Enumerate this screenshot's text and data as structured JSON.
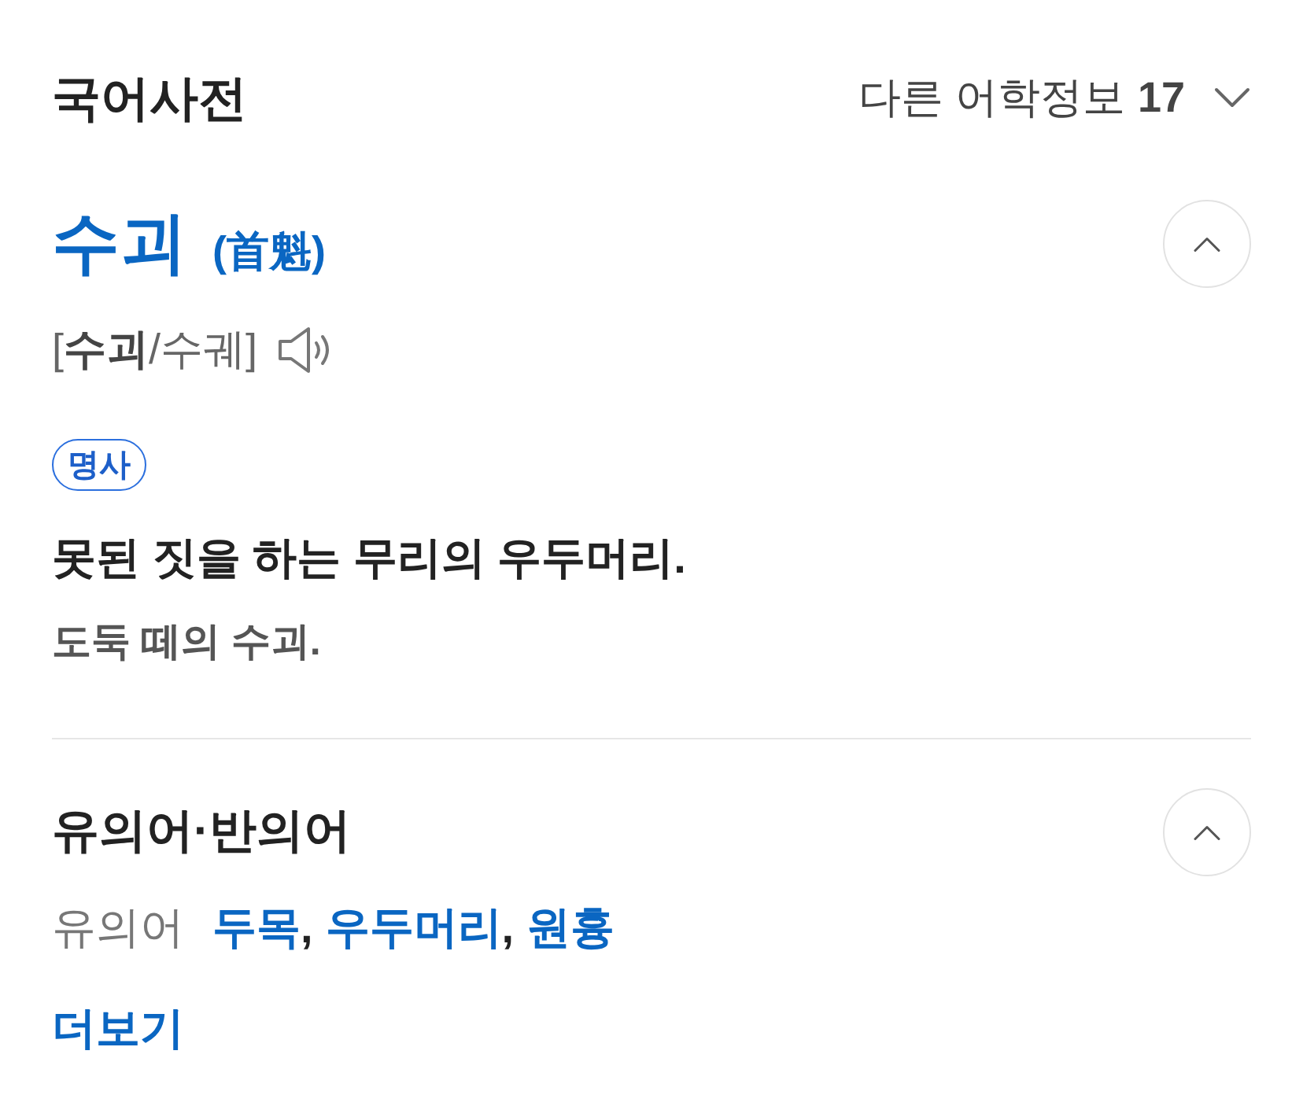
{
  "header": {
    "title": "국어사전",
    "other_info": {
      "label": "다른 어학정보",
      "count": "17",
      "expanded": false
    }
  },
  "entry": {
    "word": "수괴",
    "hanja": "(首魁)",
    "expanded": true,
    "pronunciation": "[**수괴**/수궤]",
    "part_of_speech": "명사",
    "definitions": [
      {
        "text": "못된 짓을 하는 무리의 우두머리.",
        "example": "도둑 떼의 수괴."
      }
    ]
  },
  "related": {
    "title": "유의어·반의어",
    "expanded": true,
    "groups": [
      {
        "label": "유의어",
        "separator": ",",
        "words": [
          "두목",
          "우두머리",
          "원흉"
        ]
      }
    ],
    "more": "더보기"
  }
}
